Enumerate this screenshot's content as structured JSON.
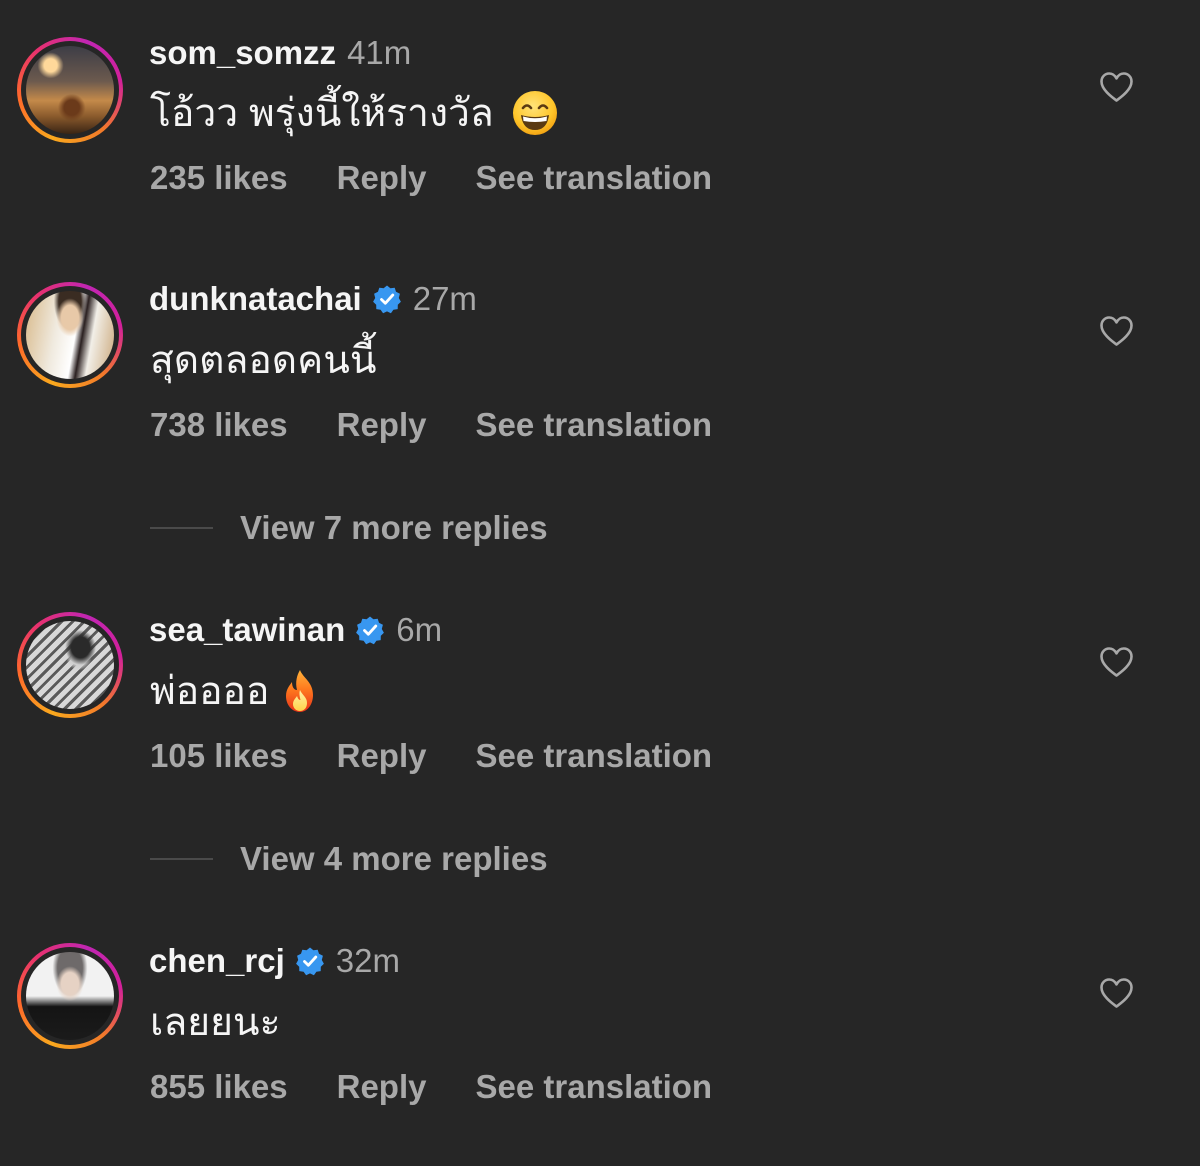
{
  "colors": {
    "background": "#262626",
    "primary_text": "#f5f5f5",
    "secondary_text": "#a8a8a8",
    "verified_blue": "#3897f0"
  },
  "comments": [
    {
      "username": "som_somzz",
      "verified": false,
      "time": "41m",
      "text": "โอ้วว พรุ่งนี้ให้รางวัล",
      "emoji": "grinning-face-with-smiling-eyes-icon",
      "likes": "235 likes",
      "reply": "Reply",
      "translation": "See translation"
    },
    {
      "username": "dunknatachai",
      "verified": true,
      "time": "27m",
      "text": "สุดตลอดคนนี้",
      "likes": "738 likes",
      "reply": "Reply",
      "translation": "See translation",
      "view_replies": "View 7 more replies"
    },
    {
      "username": "sea_tawinan",
      "verified": true,
      "time": "6m",
      "text": "พ่ออออ",
      "emoji": "fire-icon",
      "likes": "105 likes",
      "reply": "Reply",
      "translation": "See translation",
      "view_replies": "View 4 more replies"
    },
    {
      "username": "chen_rcj",
      "verified": true,
      "time": "32m",
      "text": "เลยยนะ",
      "likes": "855 likes",
      "reply": "Reply",
      "translation": "See translation"
    }
  ]
}
